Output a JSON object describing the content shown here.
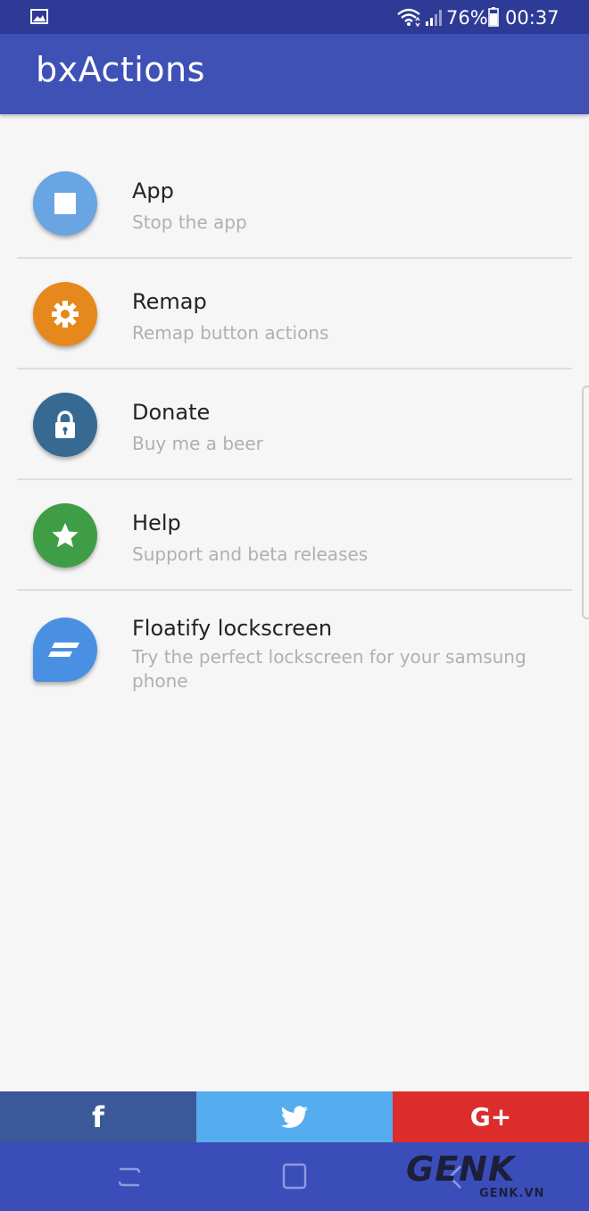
{
  "status_bar": {
    "battery": "76%",
    "time": "00:37",
    "icons": [
      "gallery-icon",
      "wifi-icon",
      "signal-icon",
      "battery-icon"
    ]
  },
  "app_bar": {
    "title": "bxActions"
  },
  "menu": {
    "items": [
      {
        "title": "App",
        "subtitle": "Stop the app",
        "icon": "stop-icon",
        "color": "#6aa5e3"
      },
      {
        "title": "Remap",
        "subtitle": "Remap button actions",
        "icon": "gear-icon",
        "color": "#e6891d"
      },
      {
        "title": "Donate",
        "subtitle": "Buy me a beer",
        "icon": "lock-icon",
        "color": "#376a92"
      },
      {
        "title": "Help",
        "subtitle": "Support and beta releases",
        "icon": "star-icon",
        "color": "#3f9d45"
      },
      {
        "title": "Floatify lockscreen",
        "subtitle": "Try the perfect lockscreen for your samsung phone",
        "icon": "floatify-chat-icon",
        "color": "#4a90e2"
      }
    ]
  },
  "share_bar": {
    "facebook": {
      "glyph": "f",
      "color": "#3b5998"
    },
    "twitter": {
      "icon": "twitter-bird-icon",
      "color": "#55acee"
    },
    "google_plus": {
      "glyph": "G+",
      "color": "#dd2c2c"
    }
  },
  "nav_bar": {
    "icons": [
      "recent-apps-icon",
      "home-icon",
      "back-icon"
    ]
  },
  "watermark": {
    "logo": "GENK",
    "site": "GENK.VN"
  }
}
